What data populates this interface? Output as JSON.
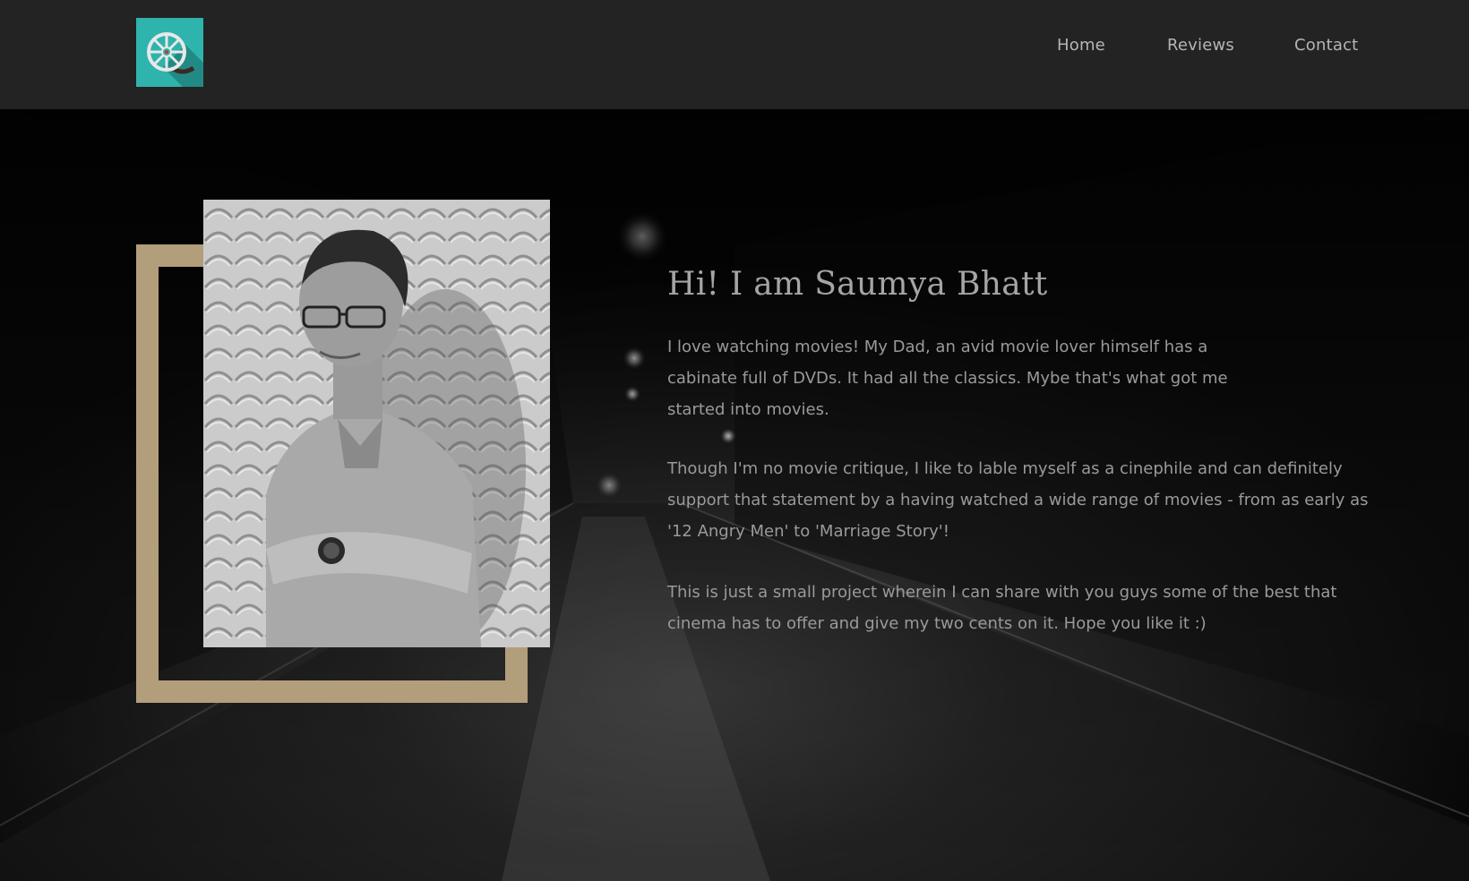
{
  "header": {
    "logo_icon": "film-reel-icon",
    "nav": [
      {
        "label": "Home"
      },
      {
        "label": "Reviews"
      },
      {
        "label": "Contact"
      }
    ]
  },
  "about": {
    "heading": "Hi! I am Saumya Bhatt",
    "paragraphs": [
      "I love watching movies! My Dad, an avid movie lover himself has a cabinate full of DVDs. It had all the classics. Mybe that's what got me started into movies.",
      "Though I'm no movie critique, I like to lable myself as a cinephile and can definitely support that statement by a having watched a wide range of movies - from as early as '12 Angry Men' to 'Marriage Story'!",
      "This is just a small project wherein I can share with you guys some of the best that cinema has to offer and give my two cents on it. Hope you like it :)"
    ]
  },
  "colors": {
    "navbar_bg": "#232323",
    "logo_bg": "#2fb3ad",
    "frame_accent": "#b39e7b",
    "nav_text": "#b5b5b5",
    "body_text": "#9a9a9a"
  }
}
